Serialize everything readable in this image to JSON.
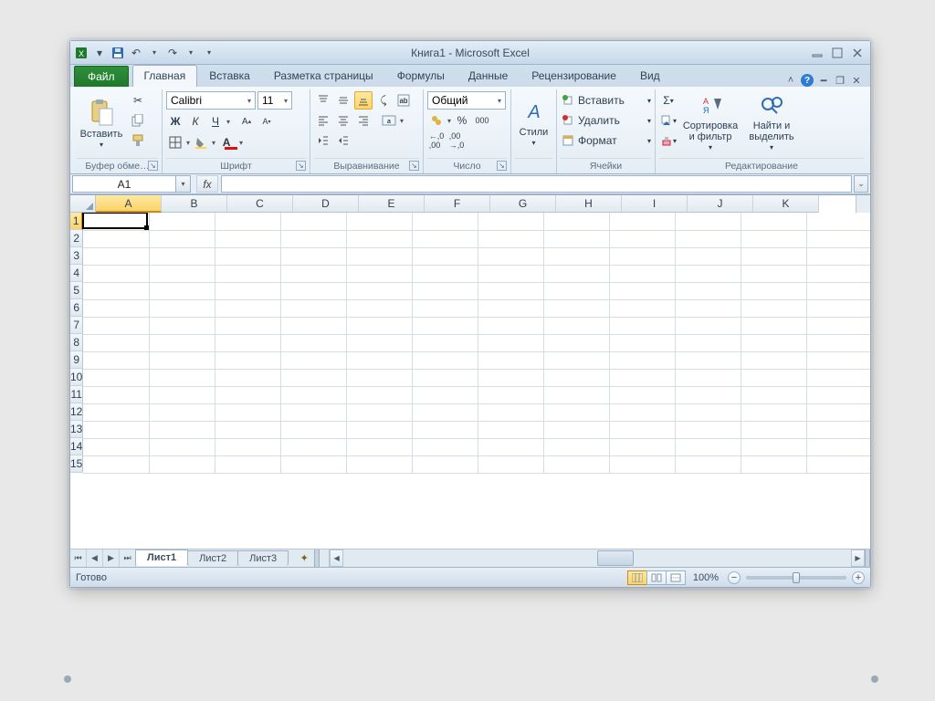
{
  "title": "Книга1  -  Microsoft Excel",
  "qat": {
    "save": "save",
    "undo": "undo",
    "redo": "redo"
  },
  "tabs": {
    "file": "Файл",
    "items": [
      "Главная",
      "Вставка",
      "Разметка страницы",
      "Формулы",
      "Данные",
      "Рецензирование",
      "Вид"
    ],
    "active_index": 0
  },
  "ribbon": {
    "clipboard": {
      "paste": "Вставить",
      "label": "Буфер обме…"
    },
    "font": {
      "name": "Calibri",
      "size": "11",
      "bold": "Ж",
      "italic": "К",
      "underline": "Ч",
      "label": "Шрифт"
    },
    "align": {
      "label": "Выравнивание"
    },
    "number": {
      "format": "Общий",
      "label": "Число",
      "percent": "%",
      "thousands": "000"
    },
    "styles": {
      "btn": "Стили"
    },
    "cells": {
      "insert": "Вставить",
      "delete": "Удалить",
      "format": "Формат",
      "label": "Ячейки"
    },
    "editing": {
      "sort": "Сортировка и фильтр",
      "find": "Найти и выделить",
      "label": "Редактирование"
    }
  },
  "formula_bar": {
    "name_box": "A1",
    "fx": "fx",
    "value": ""
  },
  "grid": {
    "columns": [
      "A",
      "B",
      "C",
      "D",
      "E",
      "F",
      "G",
      "H",
      "I",
      "J",
      "K"
    ],
    "rows": [
      "1",
      "2",
      "3",
      "4",
      "5",
      "6",
      "7",
      "8",
      "9",
      "10",
      "11",
      "12",
      "13",
      "14",
      "15"
    ],
    "active_col_index": 0,
    "active_row_index": 0
  },
  "sheet_tabs": {
    "items": [
      "Лист1",
      "Лист2",
      "Лист3"
    ],
    "active_index": 0
  },
  "status": {
    "ready": "Готово",
    "zoom": "100%"
  }
}
